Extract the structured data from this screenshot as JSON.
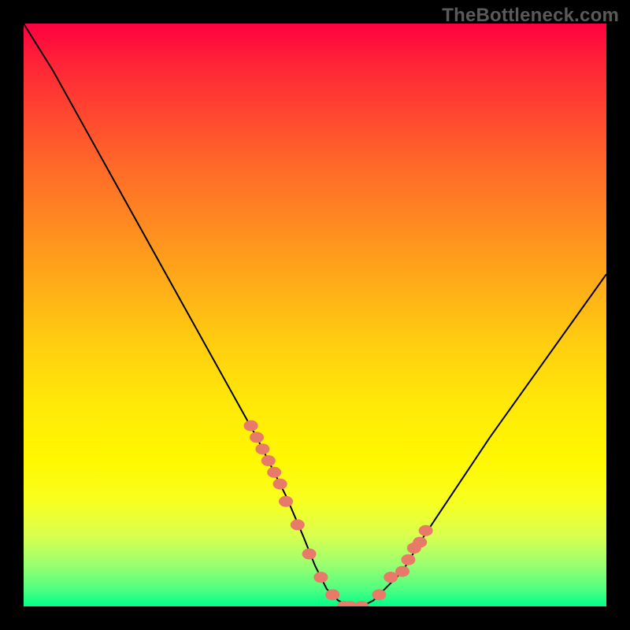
{
  "watermark": "TheBottleneck.com",
  "colors": {
    "frame": "#000000",
    "curve": "#000000",
    "markers": "#e87a6a",
    "gradient_top": "#ff0040",
    "gradient_bottom": "#00ff88"
  },
  "chart_data": {
    "type": "line",
    "title": "",
    "xlabel": "",
    "ylabel": "",
    "xlim": [
      0,
      100
    ],
    "ylim": [
      0,
      100
    ],
    "grid": false,
    "legend": false,
    "curve": {
      "name": "bottleneck-curve",
      "x": [
        0,
        5,
        10,
        15,
        20,
        25,
        30,
        35,
        40,
        45,
        48,
        50,
        52,
        54,
        56,
        58,
        60,
        62,
        65,
        68,
        72,
        76,
        80,
        85,
        90,
        95,
        100
      ],
      "y": [
        100,
        92,
        83,
        74,
        65,
        56,
        47,
        38,
        29,
        19,
        12,
        7,
        3,
        1,
        0,
        0,
        1,
        3,
        6,
        11,
        17,
        23,
        29,
        36,
        43,
        50,
        57
      ]
    },
    "markers": {
      "name": "highlight-points",
      "x": [
        39,
        40,
        41,
        42,
        43,
        44,
        45,
        47,
        49,
        51,
        53,
        55,
        56,
        58,
        61,
        63,
        65,
        66,
        67,
        68,
        69
      ],
      "y": [
        31,
        29,
        27,
        25,
        23,
        21,
        18,
        14,
        9,
        5,
        2,
        0,
        0,
        0,
        2,
        5,
        6,
        8,
        10,
        11,
        13
      ]
    }
  }
}
